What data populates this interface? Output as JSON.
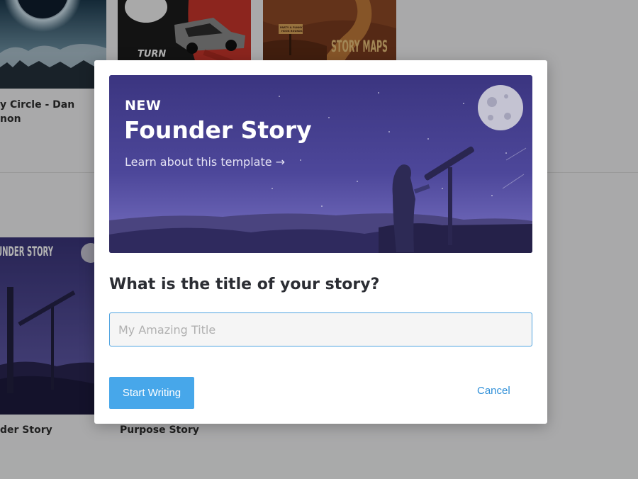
{
  "background": {
    "cards": [
      {
        "title_line1": "y Circle - Dan",
        "title_line2": "non",
        "art_text": ""
      },
      {
        "title_line1": "",
        "title_line2": "",
        "art_text": "TURN"
      },
      {
        "title_line1": "",
        "title_line2": "",
        "art_text": "STORY MAPS",
        "sign_line1": "PARTY & FUNNY",
        "sign_line2": "HOOK ROUNDS"
      },
      {
        "title_line1": "der Story",
        "art_text": "UNDER STORY"
      },
      {
        "title_line1": "Purpose Story"
      }
    ]
  },
  "modal": {
    "banner": {
      "badge": "NEW",
      "title": "Founder Story",
      "link": "Learn about this template →"
    },
    "question": "What is the title of your story?",
    "title_input": {
      "placeholder": "My Amazing Title",
      "value": ""
    },
    "start_button": "Start Writing",
    "cancel_button": "Cancel"
  },
  "colors": {
    "accent": "#47a7ea",
    "link": "#2f8fd8",
    "banner_bg": "#433e86",
    "overlay": "rgba(0,0,0,0.30)"
  }
}
